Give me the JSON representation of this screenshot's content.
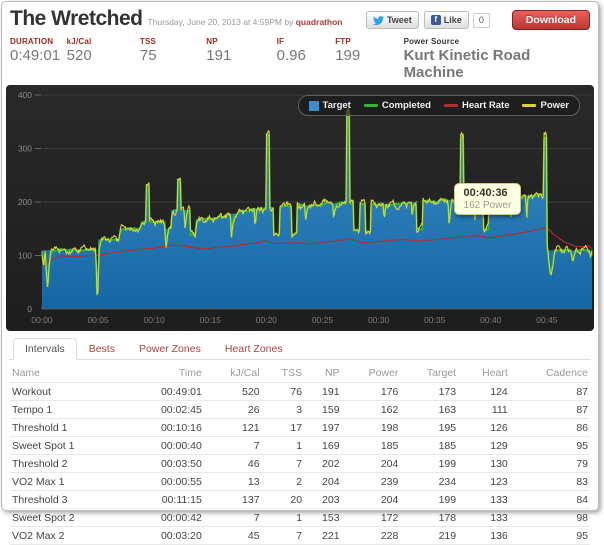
{
  "header": {
    "title": "The Wretched",
    "date_line": "Thursday, June 20, 2013 at 4:59PM by",
    "author": "quadrathon",
    "tweet_label": "Tweet",
    "like_label": "Like",
    "like_count": "0",
    "download_label": "Download"
  },
  "stats": {
    "items": [
      {
        "label": "DURATION",
        "value": "0:49:01"
      },
      {
        "label": "kJ/Cal",
        "value": "520"
      },
      {
        "label": "TSS",
        "value": "75"
      },
      {
        "label": "NP",
        "value": "191"
      },
      {
        "label": "IF",
        "value": "0.96"
      },
      {
        "label": "FTP",
        "value": "199"
      }
    ],
    "power_source_label": "Power Source",
    "power_source_value": "Kurt Kinetic Road Machine"
  },
  "tabs": {
    "items": [
      "Intervals",
      "Bests",
      "Power Zones",
      "Heart Zones"
    ],
    "active": "Intervals"
  },
  "table": {
    "headers": [
      "Name",
      "Time",
      "kJ/Cal",
      "TSS",
      "NP",
      "Power",
      "Target",
      "Heart",
      "Cadence"
    ],
    "rows": [
      [
        "Workout",
        "00:49:01",
        "520",
        "76",
        "191",
        "176",
        "173",
        "124",
        "87"
      ],
      [
        "Tempo 1",
        "00:02:45",
        "26",
        "3",
        "159",
        "162",
        "163",
        "111",
        "87"
      ],
      [
        "Threshold 1",
        "00:10:16",
        "121",
        "17",
        "197",
        "198",
        "195",
        "126",
        "86"
      ],
      [
        "Sweet Spot 1",
        "00:00:40",
        "7",
        "1",
        "169",
        "185",
        "185",
        "129",
        "95"
      ],
      [
        "Threshold 2",
        "00:03:50",
        "46",
        "7",
        "202",
        "204",
        "199",
        "130",
        "79"
      ],
      [
        "VO2 Max 1",
        "00:00:55",
        "13",
        "2",
        "204",
        "239",
        "234",
        "123",
        "83"
      ],
      [
        "Threshold 3",
        "00:11:15",
        "137",
        "20",
        "203",
        "204",
        "199",
        "133",
        "84"
      ],
      [
        "Sweet Spot 2",
        "00:00:42",
        "7",
        "1",
        "153",
        "172",
        "178",
        "133",
        "98"
      ],
      [
        "VO2 Max 2",
        "00:03:20",
        "45",
        "7",
        "221",
        "228",
        "219",
        "136",
        "95"
      ]
    ]
  },
  "colors": {
    "accent_label": "#9d2b22",
    "link_red": "#a94442",
    "download_red": "#c9302c",
    "value_gray": "#777777",
    "chart_bg": "#242424"
  },
  "chart_data": {
    "type": "area",
    "x_unit": "time",
    "x_max_min": 49.02,
    "y_max": 400,
    "y_ticks": [
      0,
      100,
      200,
      300,
      400
    ],
    "x_ticks": [
      {
        "label": "00:00",
        "min": 0
      },
      {
        "label": "00:05",
        "min": 5
      },
      {
        "label": "00:10",
        "min": 10
      },
      {
        "label": "00:15",
        "min": 15
      },
      {
        "label": "00:20",
        "min": 20
      },
      {
        "label": "00:25",
        "min": 25
      },
      {
        "label": "00:30",
        "min": 30
      },
      {
        "label": "00:35",
        "min": 35
      },
      {
        "label": "00:40",
        "min": 40
      },
      {
        "label": "00:45",
        "min": 45
      }
    ],
    "series": [
      {
        "name": "Target",
        "type": "step_area",
        "color": "#3b8ec9",
        "color_bottom": "#1566a4",
        "segments": [
          [
            0,
            110
          ],
          [
            4.85,
            30
          ],
          [
            5.0,
            130
          ],
          [
            6.9,
            150
          ],
          [
            8.8,
            163
          ],
          [
            9.3,
            230
          ],
          [
            9.55,
            163
          ],
          [
            11.0,
            150
          ],
          [
            11.5,
            185
          ],
          [
            12.1,
            240
          ],
          [
            12.35,
            185
          ],
          [
            13.2,
            140
          ],
          [
            13.7,
            168
          ],
          [
            15.5,
            172
          ],
          [
            16.5,
            178
          ],
          [
            17.5,
            183
          ],
          [
            18.5,
            188
          ],
          [
            20.0,
            325
          ],
          [
            20.3,
            188
          ],
          [
            20.6,
            140
          ],
          [
            21.2,
            192
          ],
          [
            22.2,
            140
          ],
          [
            22.7,
            194
          ],
          [
            25.0,
            198
          ],
          [
            27.15,
            365
          ],
          [
            27.45,
            198
          ],
          [
            27.8,
            145
          ],
          [
            28.3,
            198
          ],
          [
            28.85,
            145
          ],
          [
            29.3,
            196
          ],
          [
            32.0,
            199
          ],
          [
            33.4,
            150
          ],
          [
            33.9,
            201
          ],
          [
            35.5,
            204
          ],
          [
            37.3,
            320
          ],
          [
            37.55,
            207
          ],
          [
            39.3,
            150
          ],
          [
            39.8,
            208
          ],
          [
            41.0,
            210
          ],
          [
            42.5,
            212
          ],
          [
            44.3,
            214
          ],
          [
            44.7,
            320
          ],
          [
            45.0,
            110
          ]
        ]
      },
      {
        "name": "Completed",
        "type": "line",
        "color": "#2fb92f",
        "follows": "Target",
        "noise": 4
      },
      {
        "name": "Heart Rate",
        "type": "line",
        "color": "#b02e2e",
        "noise": 2.5,
        "keypoints": [
          [
            0,
            80
          ],
          [
            0.7,
            92
          ],
          [
            1.5,
            99
          ],
          [
            3,
            98
          ],
          [
            5,
            101
          ],
          [
            6.5,
            106
          ],
          [
            8,
            110
          ],
          [
            10,
            114
          ],
          [
            11.5,
            119
          ],
          [
            13,
            117
          ],
          [
            14.2,
            112
          ],
          [
            16,
            116
          ],
          [
            18,
            120
          ],
          [
            19.8,
            127
          ],
          [
            21,
            122
          ],
          [
            22.5,
            124
          ],
          [
            24,
            122
          ],
          [
            25.5,
            126
          ],
          [
            27.3,
            131
          ],
          [
            28.6,
            124
          ],
          [
            30,
            126
          ],
          [
            32,
            130
          ],
          [
            33.6,
            127
          ],
          [
            35,
            130
          ],
          [
            37,
            134
          ],
          [
            38.5,
            137
          ],
          [
            39.8,
            133
          ],
          [
            41,
            137
          ],
          [
            42.5,
            142
          ],
          [
            44,
            148
          ],
          [
            44.9,
            152
          ],
          [
            45.6,
            138
          ],
          [
            46.6,
            124
          ],
          [
            47.4,
            118
          ],
          [
            48.1,
            116
          ],
          [
            48.6,
            119
          ],
          [
            49.02,
            112
          ]
        ]
      },
      {
        "name": "Power",
        "type": "line",
        "color": "#d8d53c",
        "follows": "Target",
        "noise": 16
      }
    ],
    "dips": [
      [
        0.12,
        78,
        0.12
      ],
      [
        0.5,
        38,
        0.22
      ],
      [
        4.95,
        30,
        0.18
      ],
      [
        11.05,
        112,
        0.12
      ],
      [
        12.75,
        150,
        0.1
      ],
      [
        16.9,
        124,
        0.12
      ],
      [
        19.0,
        152,
        0.1
      ],
      [
        23.5,
        160,
        0.1
      ],
      [
        26.0,
        168,
        0.1
      ],
      [
        30.5,
        165,
        0.1
      ],
      [
        33.0,
        170,
        0.08
      ],
      [
        36.3,
        150,
        0.12
      ],
      [
        38.6,
        160,
        0.1
      ],
      [
        41.8,
        170,
        0.1
      ],
      [
        43.2,
        168,
        0.1
      ],
      [
        45.35,
        62,
        0.3
      ],
      [
        47.3,
        88,
        0.15
      ],
      [
        48.9,
        96,
        0.12
      ]
    ],
    "tooltip": {
      "time": "00:40:36",
      "value_label": "162 Power",
      "x_min": 40.6
    }
  }
}
